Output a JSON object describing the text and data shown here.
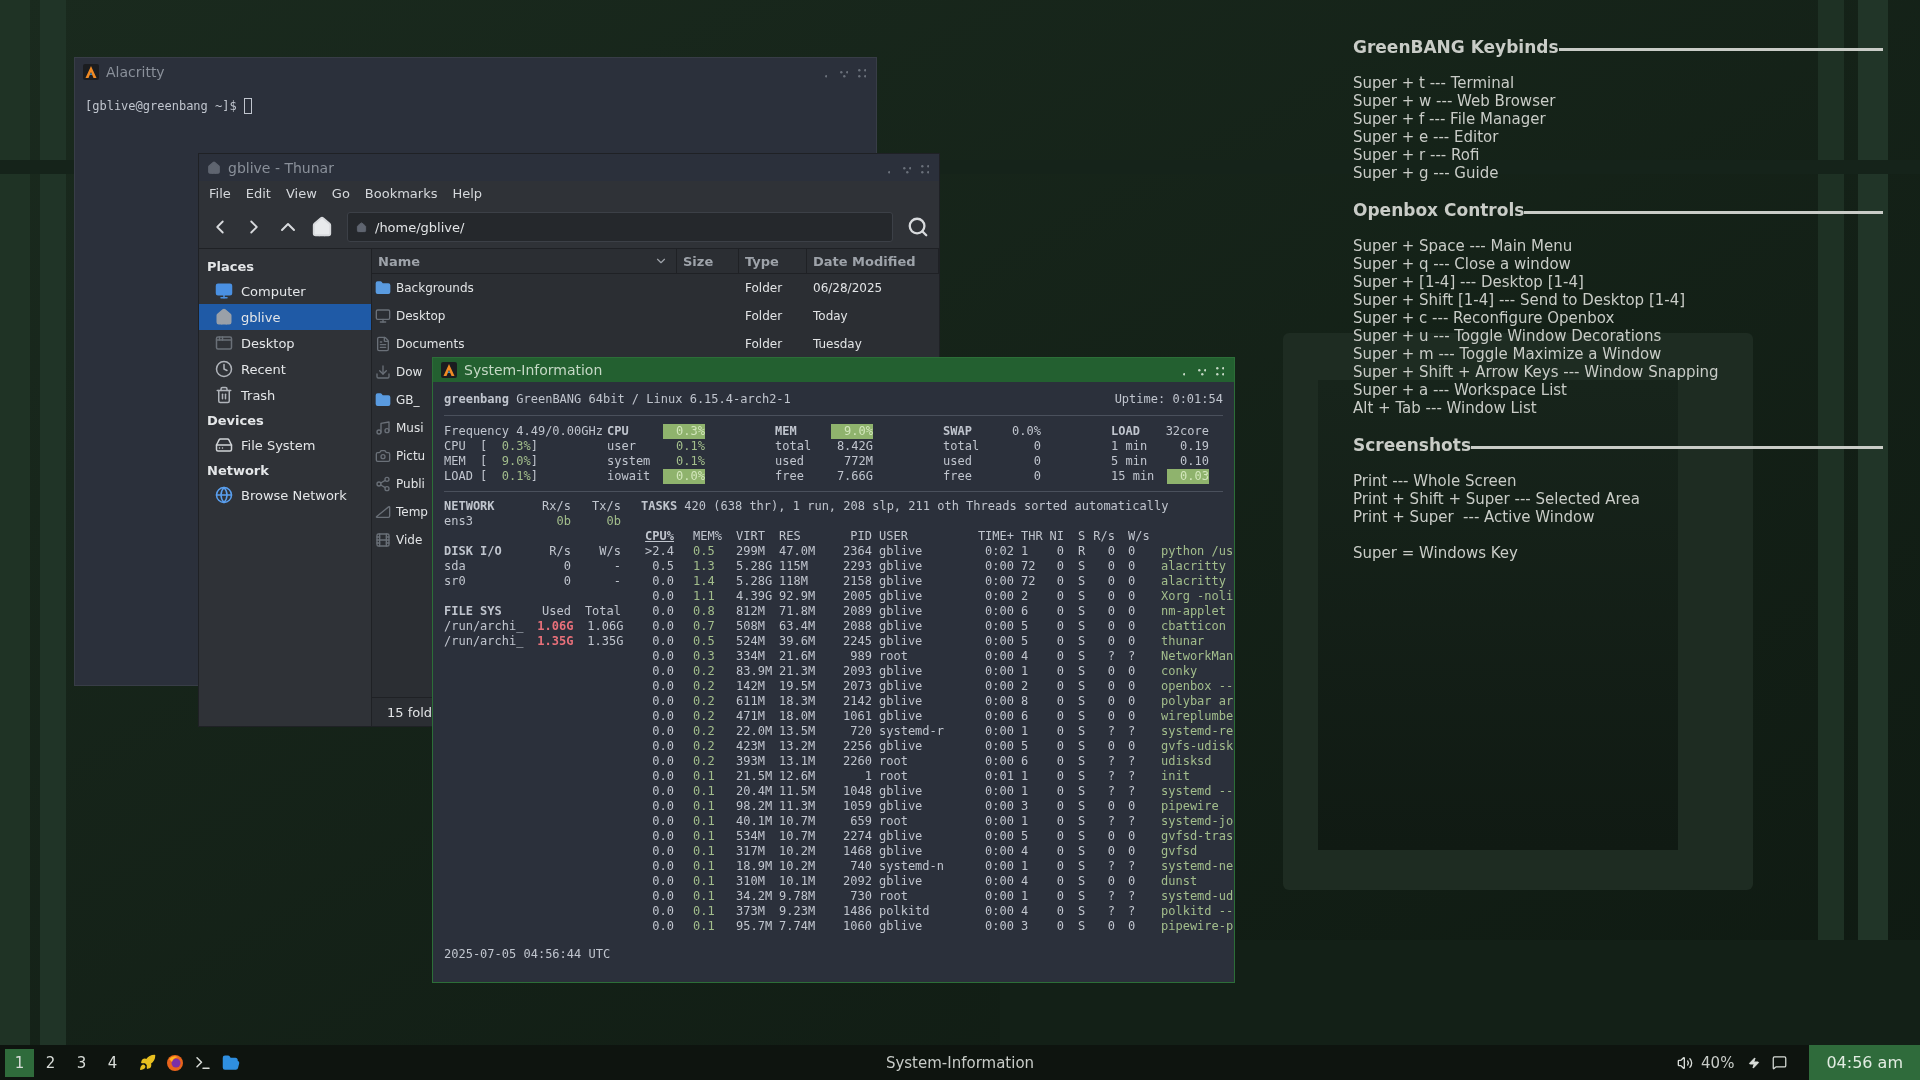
{
  "alacritty": {
    "title": "Alacritty",
    "prompt": "[gblive@greenbang ~]$"
  },
  "thunar": {
    "title": "gblive - Thunar",
    "menu": [
      "File",
      "Edit",
      "View",
      "Go",
      "Bookmarks",
      "Help"
    ],
    "path": "/home/gblive/",
    "sidebar": [
      {
        "heading": "Places",
        "items": [
          {
            "label": "Computer",
            "selected": false
          },
          {
            "label": "gblive",
            "selected": true
          },
          {
            "label": "Desktop",
            "selected": false
          },
          {
            "label": "Recent",
            "selected": false
          },
          {
            "label": "Trash",
            "selected": false
          }
        ]
      },
      {
        "heading": "Devices",
        "items": [
          {
            "label": "File System",
            "selected": false
          }
        ]
      },
      {
        "heading": "Network",
        "items": [
          {
            "label": "Browse Network",
            "selected": false
          }
        ]
      }
    ],
    "columns": [
      {
        "label": "Name",
        "sorted": true
      },
      {
        "label": "Size",
        "sorted": false
      },
      {
        "label": "Type",
        "sorted": false
      },
      {
        "label": "Date Modified",
        "sorted": false
      }
    ],
    "files": [
      {
        "name": "Backgrounds",
        "type": "Folder",
        "date": "06/28/2025"
      },
      {
        "name": "Desktop",
        "type": "Folder",
        "date": "Today"
      },
      {
        "name": "Documents",
        "type": "Folder",
        "date": "Tuesday"
      },
      {
        "name": "Dow"
      },
      {
        "name": "GB_"
      },
      {
        "name": "Musi"
      },
      {
        "name": "Pictu"
      },
      {
        "name": "Publi"
      },
      {
        "name": "Temp"
      },
      {
        "name": "Vide"
      }
    ],
    "status": "15 fold"
  },
  "sysinfo": {
    "title": "System-Information",
    "host": "greenbang",
    "system": "GreenBANG 64bit / Linux 6.15.4-arch2-1",
    "uptime": "Uptime: 0:01:54",
    "quicklook": {
      "frequency": "Frequency 4.49/0.00GHz",
      "rows": [
        {
          "label": "CPU",
          "open": "[",
          "value": "0.3%",
          "close": "]"
        },
        {
          "label": "MEM",
          "open": "[",
          "value": "9.0%",
          "close": "]"
        },
        {
          "label": "LOAD",
          "open": "[",
          "value": "0.1%",
          "close": "]"
        }
      ]
    },
    "stat_blocks": [
      {
        "title": "CPU",
        "title_value": "0.3%",
        "highlight": true,
        "rows": [
          {
            "label": "user",
            "value": "0.1%",
            "highlight": false
          },
          {
            "label": "system",
            "value": "0.1%",
            "highlight": false
          },
          {
            "label": "iowait",
            "value": "0.0%",
            "highlight": true
          }
        ]
      },
      {
        "title": "MEM",
        "title_value": "9.0%",
        "highlight": true,
        "rows": [
          {
            "label": "total",
            "value": "8.42G",
            "highlight": false
          },
          {
            "label": "used",
            "value": "772M",
            "highlight": false
          },
          {
            "label": "free",
            "value": "7.66G",
            "highlight": false
          }
        ]
      },
      {
        "title": "SWAP",
        "title_value": "0.0%",
        "highlight": false,
        "rows": [
          {
            "label": "total",
            "value": "0",
            "highlight": false
          },
          {
            "label": "used",
            "value": "0",
            "highlight": false
          },
          {
            "label": "free",
            "value": "0",
            "highlight": false
          }
        ]
      },
      {
        "title": "LOAD",
        "title_value": "32core",
        "highlight": false,
        "rows": [
          {
            "label": "1 min",
            "value": "0.19",
            "highlight": false
          },
          {
            "label": "5 min",
            "value": "0.10",
            "highlight": false
          },
          {
            "label": "15 min",
            "value": "0.03",
            "highlight": true
          }
        ]
      }
    ],
    "left_sections": [
      {
        "title": "NETWORK",
        "cols": [
          "Rx/s",
          "Tx/s"
        ],
        "rows": [
          {
            "name": "ens3",
            "values": [
              "0b",
              "0b"
            ],
            "critical": false
          }
        ]
      },
      {
        "title": "DISK I/O",
        "cols": [
          "R/s",
          "W/s"
        ],
        "rows": [
          {
            "name": "sda",
            "values": [
              "0",
              "-"
            ],
            "critical": false
          },
          {
            "name": "sr0",
            "values": [
              "0",
              "-"
            ],
            "critical": false
          }
        ]
      },
      {
        "title": "FILE SYS",
        "cols": [
          "Used",
          "Total"
        ],
        "rows": [
          {
            "name": "/run/archi_",
            "values": [
              "1.06G",
              "1.06G"
            ],
            "critical": true
          },
          {
            "name": "/run/archi_",
            "values": [
              "1.35G",
              "1.35G"
            ],
            "critical": true
          }
        ]
      }
    ],
    "tasks": {
      "label": "TASKS",
      "text": "420 (638 thr), 1 run, 208 slp, 211 oth Threads sorted automatically"
    },
    "proc_columns": [
      {
        "label": "CPU%",
        "sorted": true
      },
      {
        "label": "MEM%",
        "sorted": false
      },
      {
        "label": "VIRT",
        "sorted": false
      },
      {
        "label": "RES",
        "sorted": false
      },
      {
        "label": "PID",
        "sorted": false
      },
      {
        "label": "USER",
        "sorted": false
      },
      {
        "label": "TIME+",
        "sorted": false
      },
      {
        "label": "THR",
        "sorted": false
      },
      {
        "label": "NI",
        "sorted": false
      },
      {
        "label": "S",
        "sorted": false
      },
      {
        "label": "R/s",
        "sorted": false
      },
      {
        "label": "W/s",
        "sorted": false
      }
    ],
    "processes": [
      [
        ">2.4",
        "0.5",
        "299M",
        "47.0M",
        "2364",
        "gblive",
        "0:02",
        "1",
        "0",
        "R",
        "0",
        "0",
        "python /us"
      ],
      [
        "0.5",
        "1.3",
        "5.28G",
        "115M",
        "2293",
        "gblive",
        "0:00",
        "72",
        "0",
        "S",
        "0",
        "0",
        "alacritty"
      ],
      [
        "0.0",
        "1.4",
        "5.28G",
        "118M",
        "2158",
        "gblive",
        "0:00",
        "72",
        "0",
        "S",
        "0",
        "0",
        "alacritty"
      ],
      [
        "0.0",
        "1.1",
        "4.39G",
        "92.9M",
        "2005",
        "gblive",
        "0:00",
        "2",
        "0",
        "S",
        "0",
        "0",
        "Xorg -noli"
      ],
      [
        "0.0",
        "0.8",
        "812M",
        "71.8M",
        "2089",
        "gblive",
        "0:00",
        "6",
        "0",
        "S",
        "0",
        "0",
        "nm-applet"
      ],
      [
        "0.0",
        "0.7",
        "508M",
        "63.4M",
        "2088",
        "gblive",
        "0:00",
        "5",
        "0",
        "S",
        "0",
        "0",
        "cbatticon"
      ],
      [
        "0.0",
        "0.5",
        "524M",
        "39.6M",
        "2245",
        "gblive",
        "0:00",
        "5",
        "0",
        "S",
        "0",
        "0",
        "thunar"
      ],
      [
        "0.0",
        "0.3",
        "334M",
        "21.6M",
        "989",
        "root",
        "0:00",
        "4",
        "0",
        "S",
        "?",
        "?",
        "NetworkMan"
      ],
      [
        "0.0",
        "0.2",
        "83.9M",
        "21.3M",
        "2093",
        "gblive",
        "0:00",
        "1",
        "0",
        "S",
        "0",
        "0",
        "conky"
      ],
      [
        "0.0",
        "0.2",
        "142M",
        "19.5M",
        "2073",
        "gblive",
        "0:00",
        "2",
        "0",
        "S",
        "0",
        "0",
        "openbox --"
      ],
      [
        "0.0",
        "0.2",
        "611M",
        "18.3M",
        "2142",
        "gblive",
        "0:00",
        "8",
        "0",
        "S",
        "0",
        "0",
        "polybar ar"
      ],
      [
        "0.0",
        "0.2",
        "471M",
        "18.0M",
        "1061",
        "gblive",
        "0:00",
        "6",
        "0",
        "S",
        "0",
        "0",
        "wireplumbe"
      ],
      [
        "0.0",
        "0.2",
        "22.0M",
        "13.5M",
        "720",
        "systemd-r",
        "0:00",
        "1",
        "0",
        "S",
        "?",
        "?",
        "systemd-re"
      ],
      [
        "0.0",
        "0.2",
        "423M",
        "13.2M",
        "2256",
        "gblive",
        "0:00",
        "5",
        "0",
        "S",
        "0",
        "0",
        "gvfs-udisk"
      ],
      [
        "0.0",
        "0.2",
        "393M",
        "13.1M",
        "2260",
        "root",
        "0:00",
        "6",
        "0",
        "S",
        "?",
        "?",
        "udisksd"
      ],
      [
        "0.0",
        "0.1",
        "21.5M",
        "12.6M",
        "1",
        "root",
        "0:01",
        "1",
        "0",
        "S",
        "?",
        "?",
        "init"
      ],
      [
        "0.0",
        "0.1",
        "20.4M",
        "11.5M",
        "1048",
        "gblive",
        "0:00",
        "1",
        "0",
        "S",
        "?",
        "?",
        "systemd --"
      ],
      [
        "0.0",
        "0.1",
        "98.2M",
        "11.3M",
        "1059",
        "gblive",
        "0:00",
        "3",
        "0",
        "S",
        "0",
        "0",
        "pipewire"
      ],
      [
        "0.0",
        "0.1",
        "40.1M",
        "10.7M",
        "659",
        "root",
        "0:00",
        "1",
        "0",
        "S",
        "?",
        "?",
        "systemd-jo"
      ],
      [
        "0.0",
        "0.1",
        "534M",
        "10.7M",
        "2274",
        "gblive",
        "0:00",
        "5",
        "0",
        "S",
        "0",
        "0",
        "gvfsd-tras"
      ],
      [
        "0.0",
        "0.1",
        "317M",
        "10.2M",
        "1468",
        "gblive",
        "0:00",
        "4",
        "0",
        "S",
        "0",
        "0",
        "gvfsd"
      ],
      [
        "0.0",
        "0.1",
        "18.9M",
        "10.2M",
        "740",
        "systemd-n",
        "0:00",
        "1",
        "0",
        "S",
        "?",
        "?",
        "systemd-ne"
      ],
      [
        "0.0",
        "0.1",
        "310M",
        "10.1M",
        "2092",
        "gblive",
        "0:00",
        "4",
        "0",
        "S",
        "0",
        "0",
        "dunst"
      ],
      [
        "0.0",
        "0.1",
        "34.2M",
        "9.78M",
        "730",
        "root",
        "0:00",
        "1",
        "0",
        "S",
        "?",
        "?",
        "systemd-ud"
      ],
      [
        "0.0",
        "0.1",
        "373M",
        "9.23M",
        "1486",
        "polkitd",
        "0:00",
        "4",
        "0",
        "S",
        "?",
        "?",
        "polkitd --"
      ],
      [
        "0.0",
        "0.1",
        "95.7M",
        "7.74M",
        "1060",
        "gblive",
        "0:00",
        "3",
        "0",
        "S",
        "0",
        "0",
        "pipewire-p"
      ]
    ],
    "date": "2025-07-05 04:56:44 UTC"
  },
  "conky": {
    "sections": [
      {
        "title": "GreenBANG Keybinds",
        "lines": [
          "Super + t --- Terminal",
          "Super + w --- Web Browser",
          "Super + f --- File Manager",
          "Super + e --- Editor",
          "Super + r --- Rofi",
          "Super + g --- Guide"
        ]
      },
      {
        "title": "Openbox Controls",
        "lines": [
          "Super + Space --- Main Menu",
          "Super + q --- Close a window",
          "Super + [1-4] --- Desktop [1-4]",
          "Super + Shift [1-4] --- Send to Desktop [1-4]",
          "Super + c --- Reconfigure Openbox",
          "Super + u --- Toggle Window Decorations",
          "Super + m --- Toggle Maximize a Window",
          "Super + Shift + Arrow Keys --- Window Snapping",
          "Super + a --- Workspace List",
          "Alt + Tab --- Window List"
        ]
      },
      {
        "title": "Screenshots",
        "lines": [
          "Print --- Whole Screen",
          "Print + Shift + Super --- Selected Area",
          "Print + Super  --- Active Window"
        ],
        "note": "Super = Windows Key"
      }
    ]
  },
  "taskbar": {
    "workspaces": [
      {
        "label": "1",
        "selected": true
      },
      {
        "label": "2",
        "selected": false
      },
      {
        "label": "3",
        "selected": false
      },
      {
        "label": "4",
        "selected": false
      }
    ],
    "title": "System-Information",
    "volume": "40%",
    "clock": "04:56 am"
  }
}
